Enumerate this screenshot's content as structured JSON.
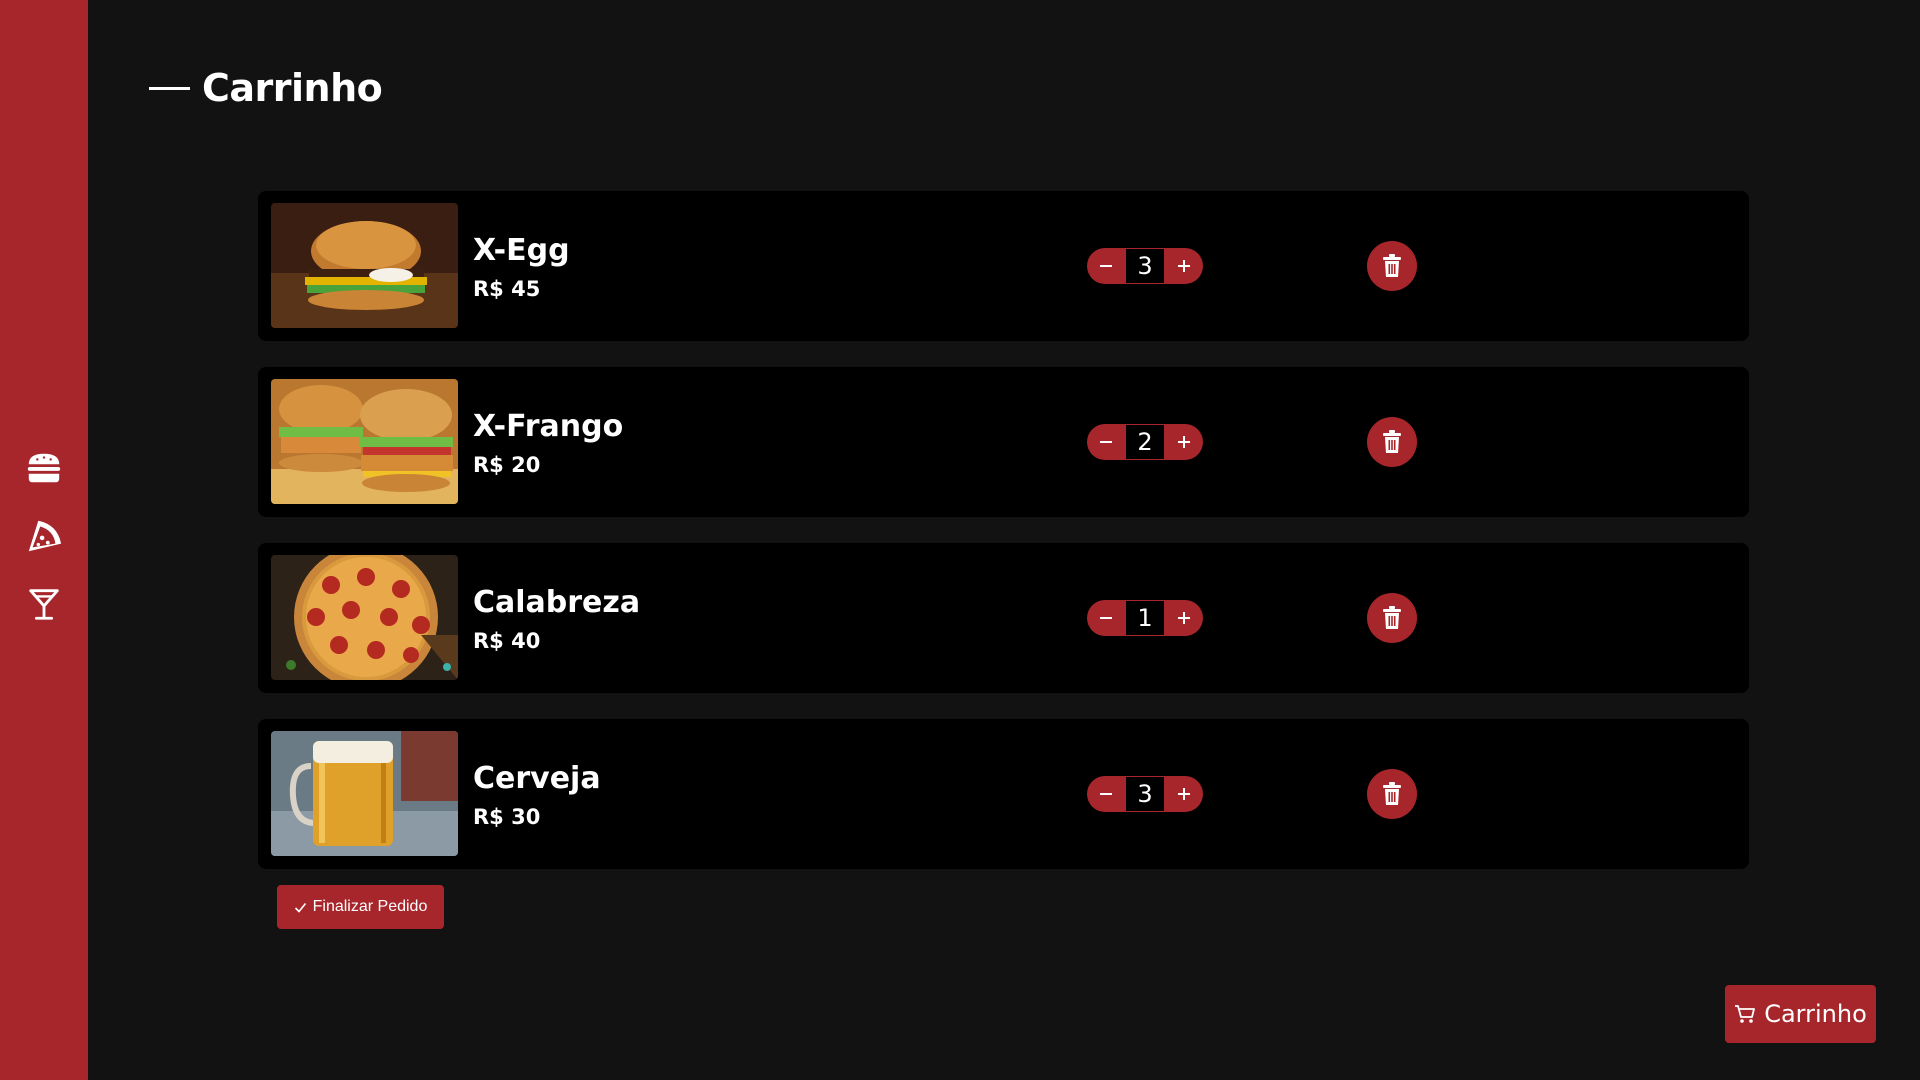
{
  "sidebar": {
    "icons": [
      {
        "name": "burger-icon"
      },
      {
        "name": "pizza-icon"
      },
      {
        "name": "cocktail-icon"
      }
    ]
  },
  "page": {
    "title": "Carrinho"
  },
  "cart": {
    "items": [
      {
        "name": "X-Egg",
        "price": "R$ 45",
        "quantity": "3",
        "image": "burger-egg-photo"
      },
      {
        "name": "X-Frango",
        "price": "R$ 20",
        "quantity": "2",
        "image": "chicken-burger-photo"
      },
      {
        "name": "Calabreza",
        "price": "R$ 40",
        "quantity": "1",
        "image": "pizza-photo"
      },
      {
        "name": "Cerveja",
        "price": "R$ 30",
        "quantity": "3",
        "image": "beer-photo"
      }
    ]
  },
  "actions": {
    "finalize_label": "Finalizar Pedido",
    "cart_label": "Carrinho"
  },
  "colors": {
    "accent": "#a7262b",
    "background": "#121212",
    "card": "#000000"
  }
}
